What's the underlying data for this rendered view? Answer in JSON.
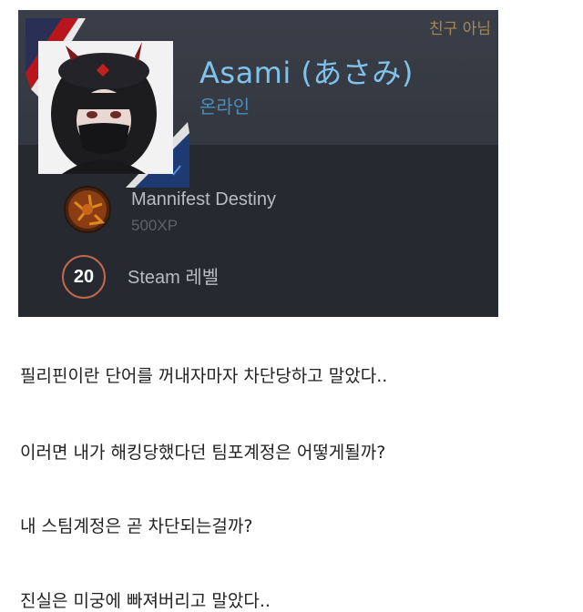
{
  "profile_card": {
    "friend_status": "친구 아님",
    "persona_name": "Asami (あさみ)",
    "online_status": "온라인",
    "badge": {
      "icon": "badge-icon",
      "name": "Mannifest Destiny",
      "xp": "500XP"
    },
    "level": {
      "value": "20",
      "label": "Steam 레벨"
    },
    "colors": {
      "card_bg": "#262930",
      "name": "#7fc3ec",
      "online": "#4c8db9",
      "friend_status": "#a98652",
      "level_ring": "#c2664d"
    }
  },
  "post": {
    "lines": [
      "필리핀이란 단어를 꺼내자마자 차단당하고 말았다..",
      "이러면 내가 해킹당했다던 팀포계정은 어떻게될까?",
      "내 스팀계정은 곧 차단되는걸까?",
      "진실은 미궁에 빠져버리고 말았다.."
    ]
  }
}
